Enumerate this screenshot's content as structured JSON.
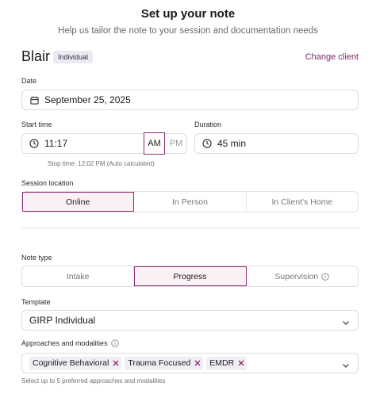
{
  "header": {
    "title": "Set up your note",
    "subtitle": "Help us tailor the note to your session and documentation needs"
  },
  "client": {
    "name": "Blair",
    "badge": "Individual",
    "change_label": "Change client"
  },
  "date": {
    "label": "Date",
    "value": "September 25, 2025"
  },
  "start_time": {
    "label": "Start time",
    "value": "11:17",
    "am_label": "AM",
    "pm_label": "PM",
    "selected": "AM",
    "stop_hint": "Stop time: 12:02 PM (Auto calculated)"
  },
  "duration": {
    "label": "Duration",
    "value": "45 min"
  },
  "session_location": {
    "label": "Session location",
    "options": [
      "Online",
      "In Person",
      "In Client's Home"
    ],
    "selected": "Online"
  },
  "note_type": {
    "label": "Note type",
    "options": [
      "Intake",
      "Progress",
      "Supervision"
    ],
    "selected": "Progress"
  },
  "template": {
    "label": "Template",
    "value": "GIRP Individual"
  },
  "approaches": {
    "label": "Approaches and modalities",
    "chips": [
      "Cognitive Behavioral",
      "Trauma Focused",
      "EMDR"
    ],
    "hint": "Select up to 5 preferred approaches and modalities"
  },
  "colors": {
    "accent": "#8c2d75",
    "link": "#7b2a66",
    "active_bg": "#fbf1f4",
    "chip_bg": "#f0eef4",
    "badge_bg": "#ece8f4"
  }
}
